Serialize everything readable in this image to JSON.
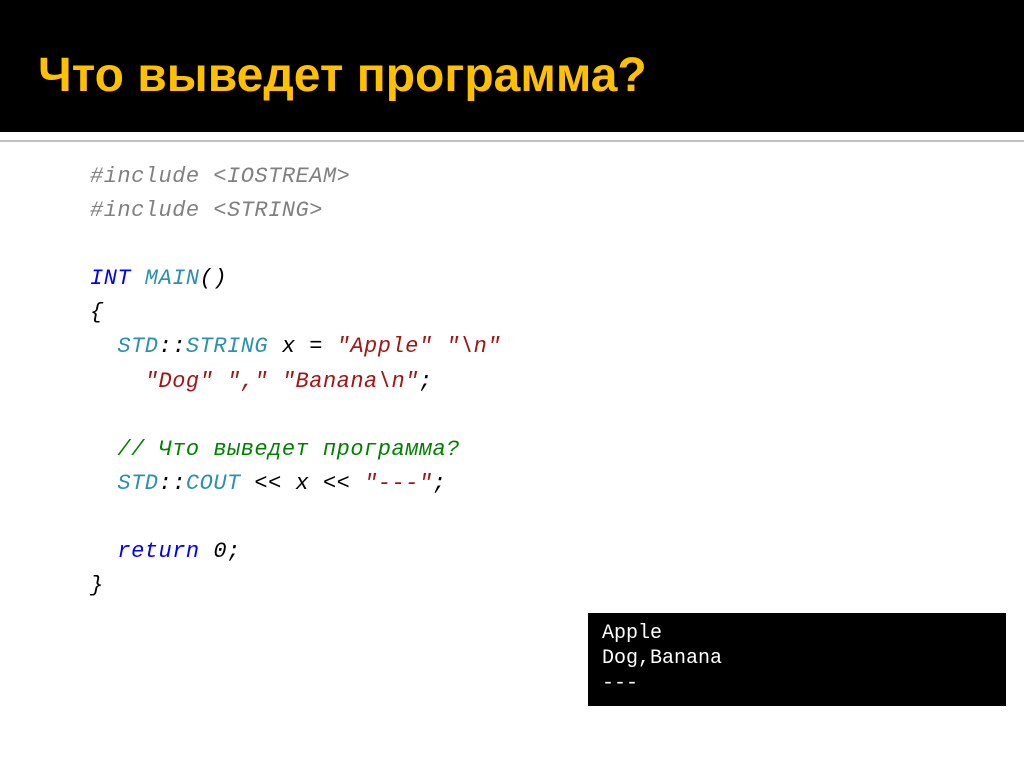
{
  "title": "Что выведет программа?",
  "code": {
    "l1a": "#include ",
    "l1b": "<IOSTREAM>",
    "l2a": "#include ",
    "l2b": "<STRING>",
    "l3a": "INT",
    "l3b": " MAIN",
    "l3c": "()",
    "l4": "{",
    "l5a": "  STD",
    "l5b": "::",
    "l5c": "STRING",
    "l5d": " x = ",
    "l5e": "\"Apple\"",
    "l5f": " ",
    "l5g": "\"\\n\"",
    "l6a": "    ",
    "l6b": "\"Dog\"",
    "l6c": " ",
    "l6d": "\",\"",
    "l6e": " ",
    "l6f": "\"Banana\\n\"",
    "l6g": ";",
    "l7": "  // Что выведет программа?",
    "l8a": "  STD",
    "l8b": "::",
    "l8c": "COUT",
    "l8d": " << x << ",
    "l8e": "\"---\"",
    "l8f": ";",
    "l9a": "  return",
    "l9b": " 0;",
    "l10": "}"
  },
  "output": "Apple\nDog,Banana\n---"
}
